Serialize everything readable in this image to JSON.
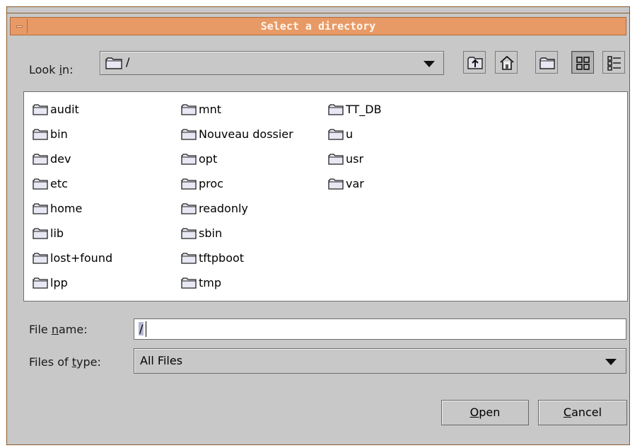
{
  "dialog": {
    "title": "Select a directory",
    "colors": {
      "titlebar": "#e89a66",
      "frame": "#8a5a2a",
      "body": "#c8c8c8"
    }
  },
  "look_in": {
    "label_pre": "Look ",
    "label_mnemonic": "i",
    "label_post": "n:",
    "value": "/",
    "icon": "folder-icon"
  },
  "toolbar": {
    "up_icon": "up-one-level-icon",
    "home_icon": "home-icon",
    "new_folder_icon": "new-folder-icon",
    "list_view_icon": "list-view-icon",
    "details_view_icon": "details-view-icon",
    "active_view": "list"
  },
  "files": {
    "columns": [
      [
        "audit",
        "bin",
        "dev",
        "etc",
        "home",
        "lib",
        "lost+found",
        "lpp"
      ],
      [
        "mnt",
        "Nouveau dossier",
        "opt",
        "proc",
        "readonly",
        "sbin",
        "tftpboot",
        "tmp"
      ],
      [
        "TT_DB",
        "u",
        "usr",
        "var"
      ]
    ]
  },
  "file_name": {
    "label_pre": "File ",
    "label_mnemonic": "n",
    "label_post": "ame:",
    "value": "/"
  },
  "files_of_type": {
    "label_pre": "Files of ",
    "label_mnemonic": "t",
    "label_post": "ype:",
    "value": "All Files"
  },
  "buttons": {
    "open_mnemonic": "O",
    "open_rest": "pen",
    "cancel_mnemonic": "C",
    "cancel_rest": "ancel"
  }
}
